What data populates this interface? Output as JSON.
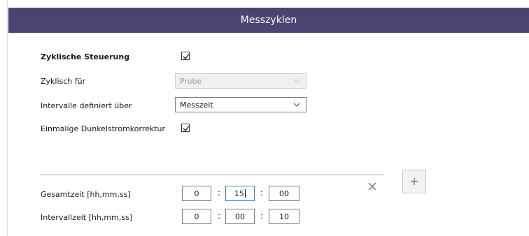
{
  "header": {
    "title": "Messzyklen"
  },
  "cyclic_control": {
    "label": "Zyklische Steuerung",
    "checked": true
  },
  "cyclic_for": {
    "label": "Zyklisch für",
    "value": "Probe",
    "disabled": true
  },
  "interval_defined": {
    "label": "Intervalle definiert über",
    "value": "Messzeit"
  },
  "dark_current": {
    "label": "Einmalige Dunkelstromkorrektur",
    "checked": true
  },
  "total_time": {
    "label": "Gesamtzeit [hh,mm,ss]",
    "hh": "0",
    "mm": "15",
    "ss": "00"
  },
  "interval_time": {
    "label": "Intervallzeit [hh,mm,ss]",
    "hh": "0",
    "mm": "00",
    "ss": "10"
  },
  "separator": ":",
  "icons": {
    "close": "close-icon",
    "add": "plus-icon",
    "check": "check-icon",
    "chevron": "chevron-down-icon"
  },
  "colors": {
    "header_bg": "#4a4473",
    "focus": "#3c7fc1"
  }
}
